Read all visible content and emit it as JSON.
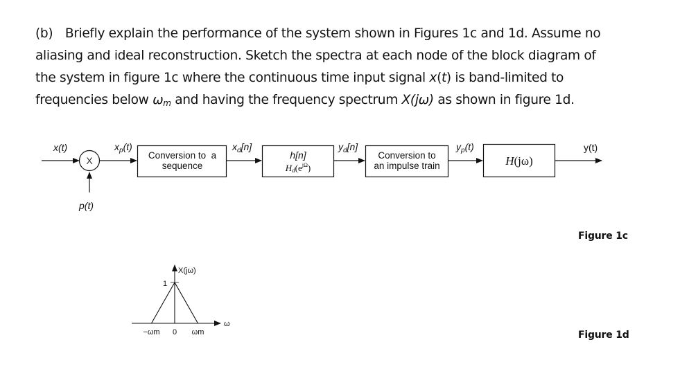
{
  "question": {
    "part_label": "(b)",
    "lines": [
      "Briefly explain the performance of the system shown in Figures 1c and 1d. Assume no",
      "aliasing and ideal reconstruction. Sketch the spectra at each node of the block diagram of",
      "the system in figure 1c where the continuous time input signal ",
      "frequencies below "
    ],
    "line3_signal": "x",
    "line3_arg": "t",
    "line3_tail": " is band-limited to",
    "line4_omega": "ω",
    "line4_sub": "m",
    "line4_mid": " and having the frequency spectrum ",
    "line4_spectrum": "X(jω)",
    "line4_tail": " as shown in figure 1d."
  },
  "figure_1c": {
    "caption": "Figure 1c",
    "signals": {
      "input": "x(t)",
      "carrier": "p(t)",
      "multiplier_symbol": "X",
      "xp": "x",
      "xp_sub": "p",
      "xp_arg": "(t)",
      "xd": "x",
      "xd_sub": "d",
      "xd_arg": "[n]",
      "yd": "y",
      "yd_sub": "d",
      "yd_arg": "[n]",
      "yp": "y",
      "yp_sub": "p",
      "yp_arg": "(t)",
      "output": "y(t)"
    },
    "blocks": [
      {
        "id": "c2d",
        "lines": [
          "Conversion to  a",
          "sequence"
        ]
      },
      {
        "id": "dt-filter",
        "line1": "h[n]",
        "line2_main": "H",
        "line2_sub": "d",
        "line2_arg_open": "(e",
        "line2_exp": "jΩ",
        "line2_arg_close": ")"
      },
      {
        "id": "d2c",
        "lines": [
          "Conversion to",
          "an impulse train"
        ]
      },
      {
        "id": "reconstruction",
        "label_main": "H",
        "label_arg": "(jω)"
      }
    ]
  },
  "figure_1d": {
    "caption": "Figure 1d",
    "y_axis_label": "X(jω)",
    "x_axis_label": "ω",
    "peak_label": "1",
    "ticks": [
      "−ωm",
      "0",
      "ωm"
    ]
  },
  "chart_data": {
    "type": "line",
    "title": "X(jω)",
    "xlabel": "ω",
    "ylabel": "X(jω)",
    "x": [
      -1,
      0,
      1
    ],
    "x_units": "ωm",
    "series": [
      {
        "name": "X(jω)",
        "values": [
          0,
          1,
          0
        ]
      }
    ],
    "tick_labels": [
      "−ωm",
      "0",
      "ωm"
    ],
    "ylim": [
      0,
      1
    ],
    "grid": false
  }
}
